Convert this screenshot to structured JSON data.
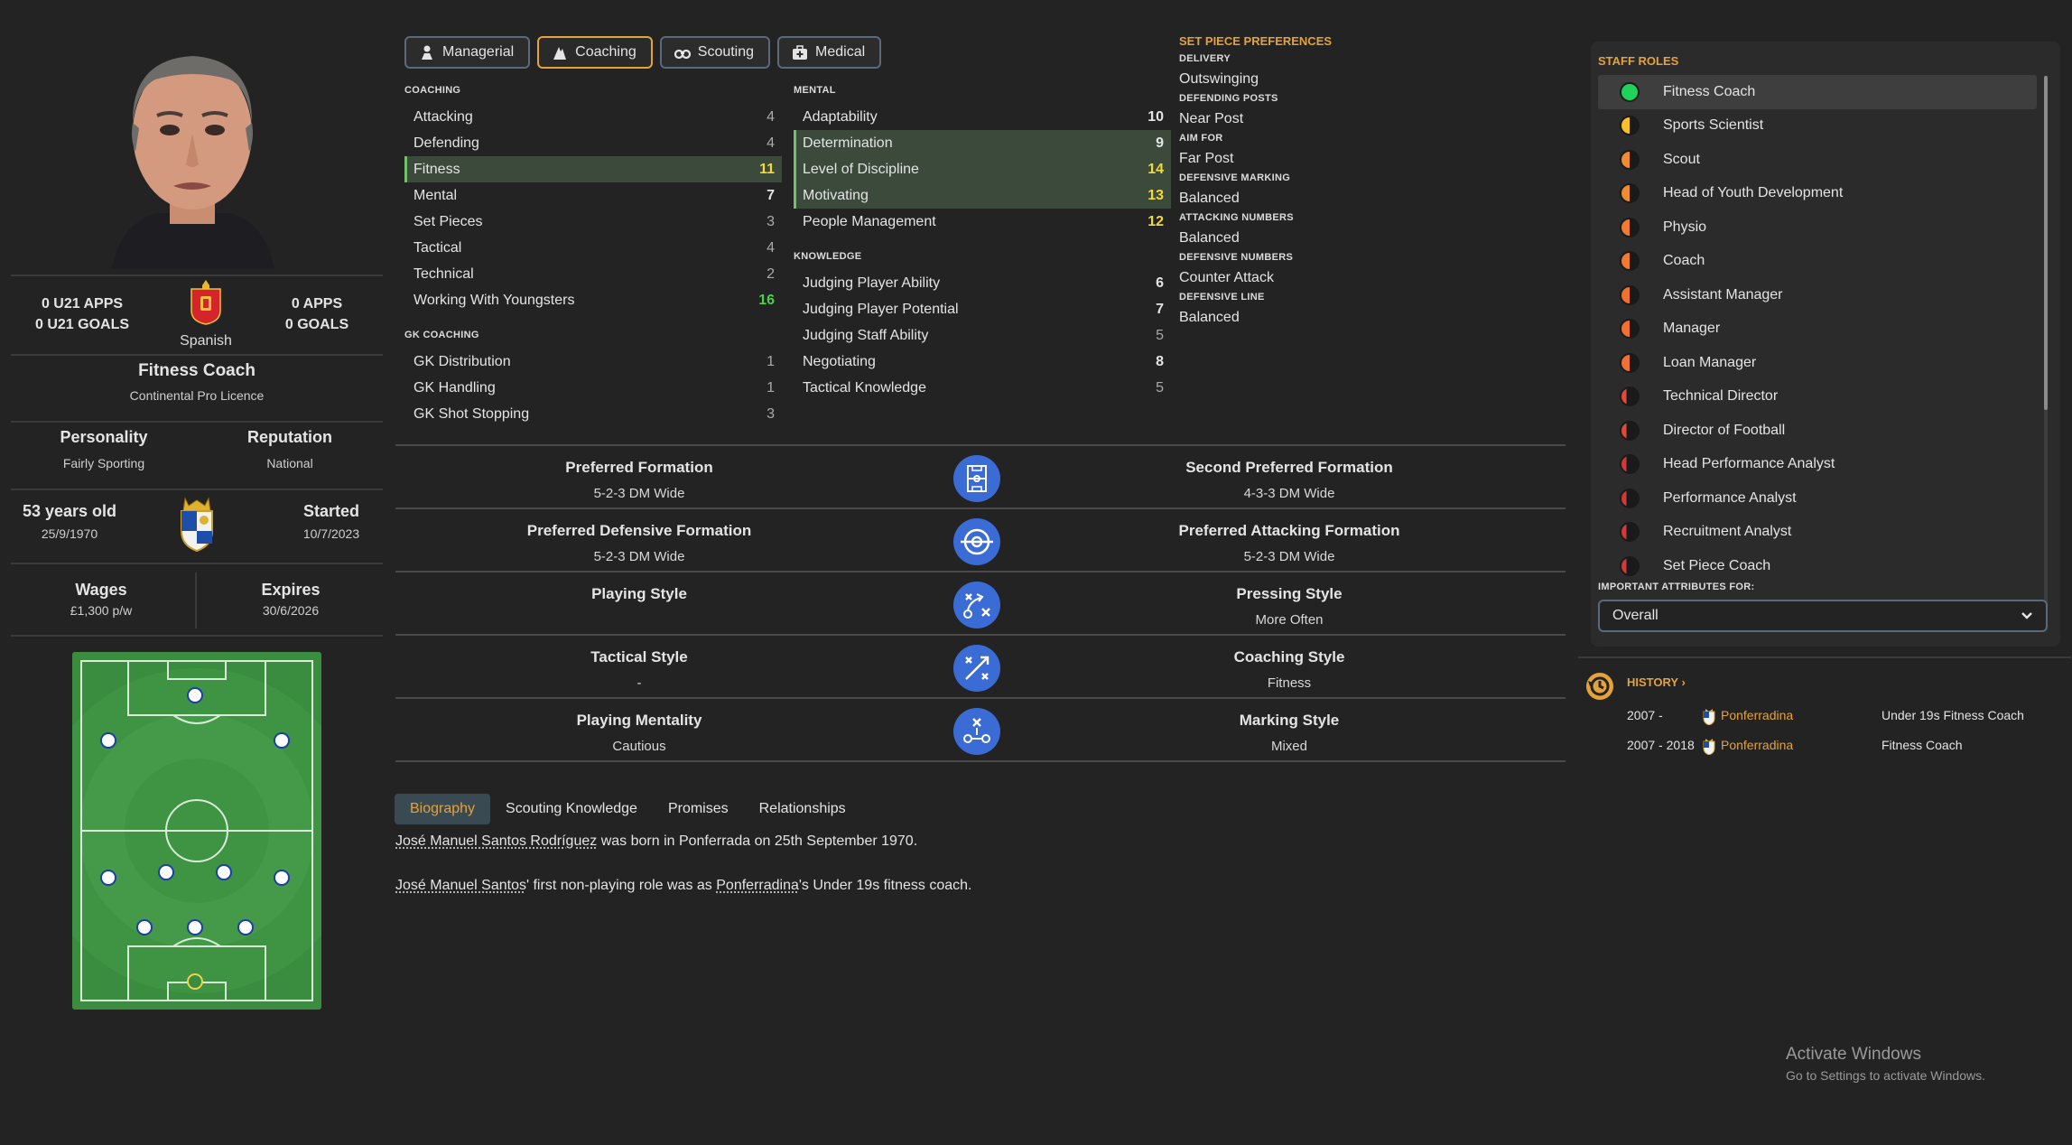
{
  "profile": {
    "u21_apps": "0 U21 APPS",
    "u21_goals": "0 U21 GOALS",
    "nationality": "Spanish",
    "apps": "0 APPS",
    "goals": "0 GOALS",
    "role": "Fitness Coach",
    "licence": "Continental Pro Licence",
    "personality_label": "Personality",
    "personality": "Fairly Sporting",
    "reputation_label": "Reputation",
    "reputation": "National",
    "age": "53 years old",
    "dob": "25/9/1970",
    "started_label": "Started",
    "started": "10/7/2023",
    "wages_label": "Wages",
    "wages": "£1,300 p/w",
    "expires_label": "Expires",
    "expires": "30/6/2026"
  },
  "tabs": [
    {
      "label": "Managerial",
      "icon": "manager-icon"
    },
    {
      "label": "Coaching",
      "icon": "coaching-icon"
    },
    {
      "label": "Scouting",
      "icon": "binoculars-icon"
    },
    {
      "label": "Medical",
      "icon": "medkit-icon"
    }
  ],
  "coaching": {
    "title": "COACHING",
    "rows": [
      {
        "name": "Attacking",
        "value": "4",
        "tone": "grey"
      },
      {
        "name": "Defending",
        "value": "4",
        "tone": "grey"
      },
      {
        "name": "Fitness",
        "value": "11",
        "tone": "yellow"
      },
      {
        "name": "Mental",
        "value": "7",
        "tone": "white"
      },
      {
        "name": "Set Pieces",
        "value": "3",
        "tone": "grey"
      },
      {
        "name": "Tactical",
        "value": "4",
        "tone": "grey"
      },
      {
        "name": "Technical",
        "value": "2",
        "tone": "grey"
      },
      {
        "name": "Working With Youngsters",
        "value": "16",
        "tone": "green"
      }
    ]
  },
  "gk_coaching": {
    "title": "GK COACHING",
    "rows": [
      {
        "name": "GK Distribution",
        "value": "1",
        "tone": "grey"
      },
      {
        "name": "GK Handling",
        "value": "1",
        "tone": "grey"
      },
      {
        "name": "GK Shot Stopping",
        "value": "3",
        "tone": "grey"
      }
    ]
  },
  "mental": {
    "title": "MENTAL",
    "rows": [
      {
        "name": "Adaptability",
        "value": "10",
        "tone": "white"
      },
      {
        "name": "Determination",
        "value": "9",
        "tone": "white"
      },
      {
        "name": "Level of Discipline",
        "value": "14",
        "tone": "yellow"
      },
      {
        "name": "Motivating",
        "value": "13",
        "tone": "yellow"
      },
      {
        "name": "People Management",
        "value": "12",
        "tone": "yellow"
      }
    ]
  },
  "knowledge": {
    "title": "KNOWLEDGE",
    "rows": [
      {
        "name": "Judging Player Ability",
        "value": "6",
        "tone": "white"
      },
      {
        "name": "Judging Player Potential",
        "value": "7",
        "tone": "white"
      },
      {
        "name": "Judging Staff Ability",
        "value": "5",
        "tone": "grey"
      },
      {
        "name": "Negotiating",
        "value": "8",
        "tone": "white"
      },
      {
        "name": "Tactical Knowledge",
        "value": "5",
        "tone": "grey"
      }
    ]
  },
  "set_piece": {
    "title": "SET PIECE PREFERENCES",
    "items": [
      {
        "key": "DELIVERY",
        "value": "Outswinging"
      },
      {
        "key": "DEFENDING POSTS",
        "value": "Near Post"
      },
      {
        "key": "AIM FOR",
        "value": "Far Post"
      },
      {
        "key": "DEFENSIVE MARKING",
        "value": "Balanced"
      },
      {
        "key": "ATTACKING NUMBERS",
        "value": "Balanced"
      },
      {
        "key": "DEFENSIVE NUMBERS",
        "value": "Counter Attack"
      },
      {
        "key": "DEFENSIVE LINE",
        "value": "Balanced"
      }
    ]
  },
  "formations": [
    {
      "left_key": "Preferred Formation",
      "left_val": "5-2-3 DM Wide",
      "icon": "pitch-icon",
      "right_key": "Second Preferred Formation",
      "right_val": "4-3-3 DM Wide"
    },
    {
      "left_key": "Preferred Defensive Formation",
      "left_val": "5-2-3 DM Wide",
      "icon": "target-icon",
      "right_key": "Preferred Attacking Formation",
      "right_val": "5-2-3 DM Wide"
    },
    {
      "left_key": "Playing Style",
      "left_val": "",
      "icon": "tactics-icon",
      "right_key": "Pressing Style",
      "right_val": "More Often"
    },
    {
      "left_key": "Tactical Style",
      "left_val": "-",
      "icon": "crossed-arrows-icon",
      "right_key": "Coaching Style",
      "right_val": "Fitness"
    },
    {
      "left_key": "Playing Mentality",
      "left_val": "Cautious",
      "icon": "mentality-icon",
      "right_key": "Marking Style",
      "right_val": "Mixed"
    }
  ],
  "bio_tabs": [
    "Biography",
    "Scouting Knowledge",
    "Promises",
    "Relationships"
  ],
  "bio": {
    "p1_name": "José Manuel Santos Rodríguez",
    "p1_rest": " was born in Ponferrada on 25th September 1970.",
    "p2_name": "José Manuel Santos",
    "p2_mid": "' first non-playing role was as ",
    "p2_club": "Ponferradina",
    "p2_rest": "'s Under 19s fitness coach."
  },
  "staff_roles": {
    "title": "STAFF ROLES",
    "roles": [
      {
        "name": "Fitness Coach",
        "color": "#1ed35a",
        "kind": "full"
      },
      {
        "name": "Sports Scientist",
        "color": "#f5c028",
        "kind": "half"
      },
      {
        "name": "Scout",
        "color": "#f08c30",
        "kind": "half"
      },
      {
        "name": "Head of Youth Development",
        "color": "#f08c30",
        "kind": "half"
      },
      {
        "name": "Physio",
        "color": "#f07a30",
        "kind": "half"
      },
      {
        "name": "Coach",
        "color": "#f07a30",
        "kind": "half"
      },
      {
        "name": "Assistant Manager",
        "color": "#f07030",
        "kind": "half"
      },
      {
        "name": "Manager",
        "color": "#f07030",
        "kind": "half"
      },
      {
        "name": "Loan Manager",
        "color": "#f07030",
        "kind": "half"
      },
      {
        "name": "Technical Director",
        "color": "#e04a3a",
        "kind": "quarter"
      },
      {
        "name": "Director of Football",
        "color": "#e04a3a",
        "kind": "quarter"
      },
      {
        "name": "Head Performance Analyst",
        "color": "#d03a3a",
        "kind": "quarter"
      },
      {
        "name": "Performance Analyst",
        "color": "#d03a3a",
        "kind": "quarter"
      },
      {
        "name": "Recruitment Analyst",
        "color": "#d03a3a",
        "kind": "quarter"
      },
      {
        "name": "Set Piece Coach",
        "color": "#d03a3a",
        "kind": "quarter"
      }
    ],
    "important_label": "IMPORTANT ATTRIBUTES FOR:",
    "important_value": "Overall"
  },
  "history": {
    "title": "HISTORY",
    "rows": [
      {
        "years": "2007 -",
        "club": "Ponferradina",
        "role": "Under 19s Fitness Coach"
      },
      {
        "years": "2007 - 2018",
        "club": "Ponferradina",
        "role": "Fitness Coach"
      }
    ]
  },
  "watermark": {
    "line1": "Activate Windows",
    "line2": "Go to Settings to activate Windows."
  }
}
